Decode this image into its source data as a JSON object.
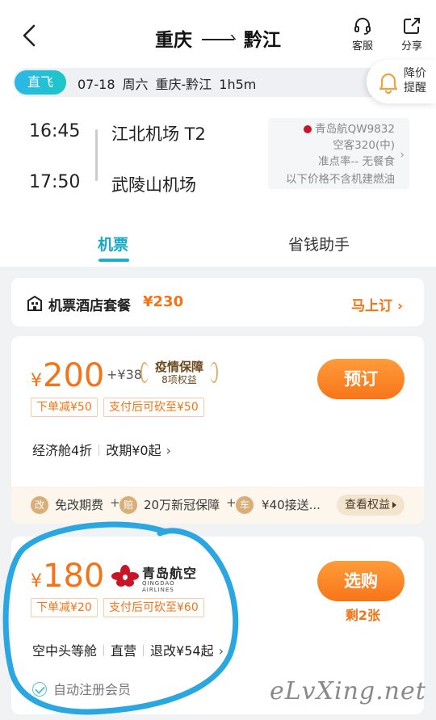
{
  "header": {
    "origin": "重庆",
    "destination": "黔江",
    "service_label": "客服",
    "share_label": "分享"
  },
  "info_bar": {
    "tag": "直飞",
    "date": "07-18",
    "weekday": "周六",
    "route": "重庆-黔江",
    "duration": "1h5m",
    "price_alert": "降价提醒"
  },
  "flight": {
    "dep_time": "16:45",
    "dep_airport": "江北机场 T2",
    "arr_time": "17:50",
    "arr_airport": "武陵山机场",
    "airline": "青岛航QW9832",
    "aircraft": "空客320(中)",
    "punctuality": "准点率-- 无餐食",
    "price_note": "以下价格不含机建燃油"
  },
  "tabs": [
    {
      "label": "机票"
    },
    {
      "label": "省钱助手"
    }
  ],
  "package": {
    "name": "机票酒店套餐",
    "price": "¥230",
    "action": "马上订 ›"
  },
  "offer1": {
    "currency": "¥",
    "price": "200",
    "extra": "+¥38",
    "badge_title": "疫情保障",
    "badge_sub": "8项权益",
    "coupon1": "下单减¥50",
    "coupon2": "支付后可砍至¥50",
    "cabin": "经济舱4折",
    "change": "改期¥0起",
    "chevron": "›",
    "button": "预订",
    "benefits": [
      {
        "icon": "改",
        "text": "免改期费"
      },
      {
        "icon": "赔",
        "text": "20万新冠保障"
      },
      {
        "icon": "车",
        "text": "¥40接送..."
      }
    ],
    "view_rights": "查看权益"
  },
  "offer2": {
    "currency": "¥",
    "price": "180",
    "logo_cn": "青岛航空",
    "logo_en": "QINGDAO AIRLINES",
    "coupon1": "下单减¥20",
    "coupon2": "支付后可砍至¥60",
    "cabin": "空中头等舱",
    "direct": "直营",
    "change": "退改¥54起",
    "chevron": "›",
    "button": "选购",
    "remain": "剩2张",
    "member": "自动注册会员"
  },
  "watermark": "eLvXing.net",
  "colors": {
    "accent": "#19b1cf",
    "orange": "#f37416",
    "annotation": "#2aa6e0"
  }
}
